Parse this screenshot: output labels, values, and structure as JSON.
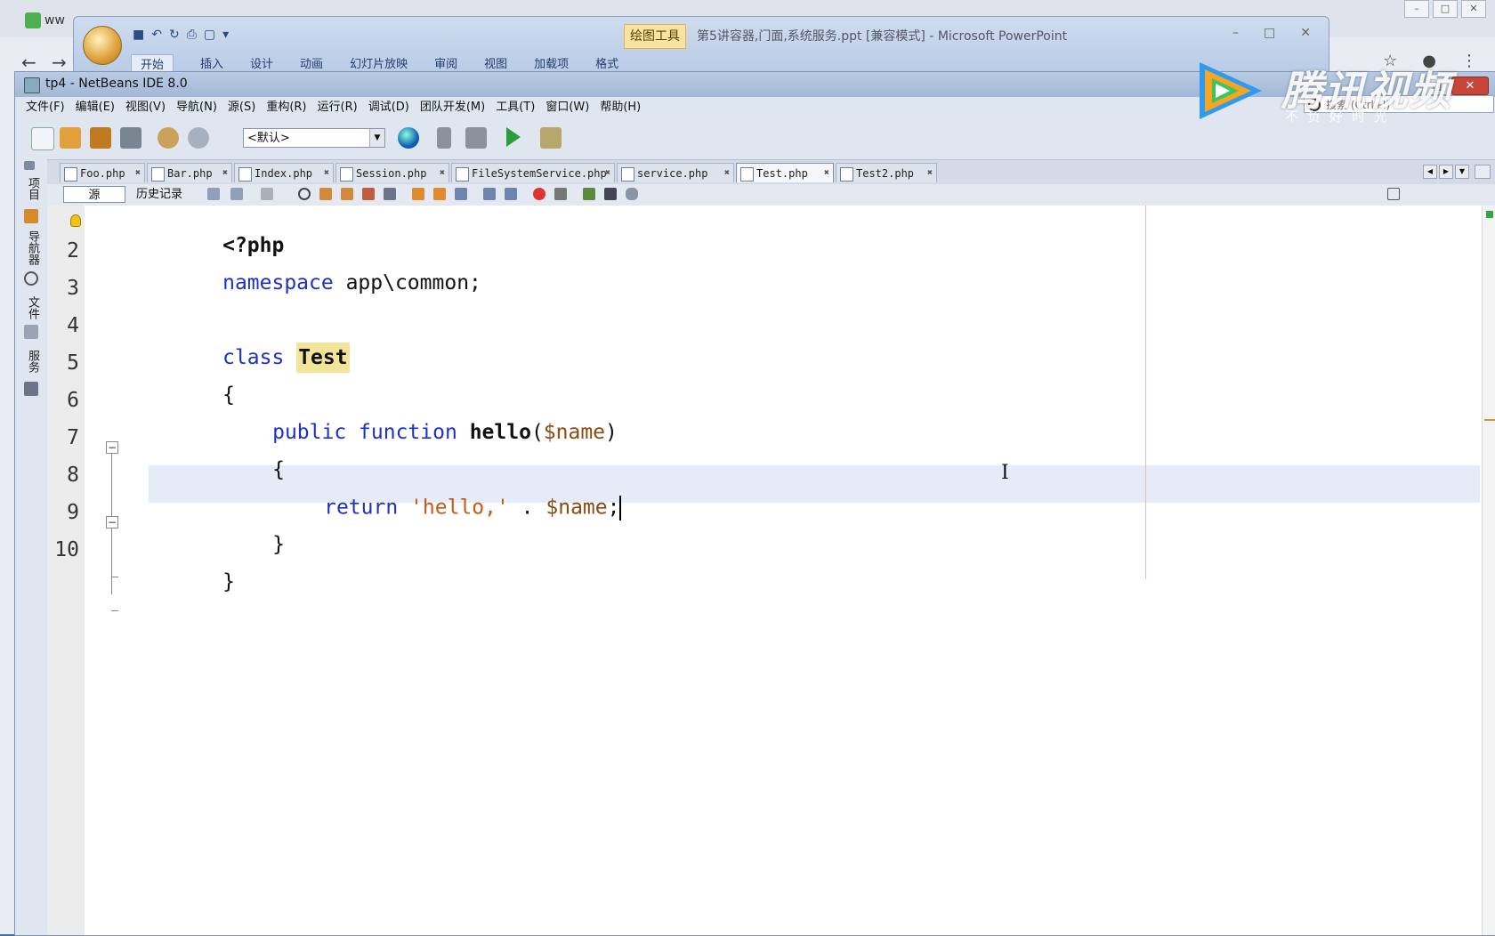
{
  "browser": {
    "tab_label": "ww",
    "back": "←",
    "forward": "→",
    "star": "☆",
    "account": "●",
    "menu": "⋮"
  },
  "ppt": {
    "drawing_tools_label": "绘图工具",
    "title": "第5讲容器,门面,系统服务.ppt [兼容模式] - Microsoft PowerPoint",
    "tabs": [
      "开始",
      "插入",
      "设计",
      "动画",
      "幻灯片放映",
      "审阅",
      "视图",
      "加载项",
      "格式"
    ],
    "minimize": "–",
    "maximize": "□",
    "close": "✕"
  },
  "netbeans": {
    "title": "tp4 - NetBeans IDE 8.0",
    "close_label": "✕",
    "max_label": "□",
    "menu": [
      "文件(F)",
      "编辑(E)",
      "视图(V)",
      "导航(N)",
      "源(S)",
      "重构(R)",
      "运行(R)",
      "调试(D)",
      "团队开发(M)",
      "工具(T)",
      "窗口(W)",
      "帮助(H)"
    ],
    "config_dropdown": "<默认>",
    "search_placeholder": "搜索 (Ctrl+I)",
    "side_panels": [
      "项目",
      "导航器",
      "文件",
      "服务"
    ],
    "editor_tabs": [
      {
        "label": "Foo.php"
      },
      {
        "label": "Bar.php"
      },
      {
        "label": "Index.php"
      },
      {
        "label": "Session.php"
      },
      {
        "label": "FileSystemService.php"
      },
      {
        "label": "service.php"
      },
      {
        "label": "Test.php",
        "active": true
      },
      {
        "label": "Test2.php"
      }
    ],
    "source_tab": "源",
    "history_tab": "历史记录",
    "line_numbers": [
      "",
      "2",
      "3",
      "4",
      "5",
      "6",
      "7",
      "8",
      "9",
      "10"
    ],
    "code": {
      "l1_open": "<?php",
      "l2_kw": "namespace",
      "l2_rest": " app\\common;",
      "l4_kw": "class",
      "l4_name": "Test",
      "l5": "{",
      "l6_public": "public",
      "l6_function": "function",
      "l6_name": "hello",
      "l6_paren_open": "(",
      "l6_param": "$name",
      "l6_paren_close": ")",
      "l7": "{",
      "l8_return": "return",
      "l8_str": "'hello,'",
      "l8_dot": " . ",
      "l8_var": "$name",
      "l8_semi": ";",
      "l9": "}",
      "l10": "}"
    }
  },
  "watermark": {
    "brand": "腾讯视频",
    "slogan": "不负好时光"
  }
}
